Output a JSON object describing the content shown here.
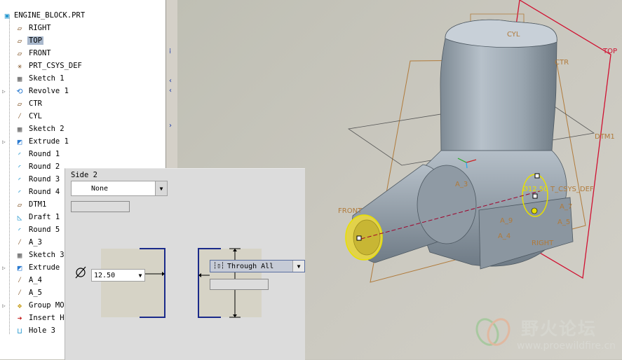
{
  "model_tree": {
    "items": [
      {
        "label": "ENGINE_BLOCK.PRT",
        "icon": "part-icon",
        "expand": ""
      },
      {
        "label": "RIGHT",
        "icon": "datum-plane-icon",
        "expand": ""
      },
      {
        "label": "TOP",
        "icon": "datum-plane-icon",
        "expand": "",
        "selected": true
      },
      {
        "label": "FRONT",
        "icon": "datum-plane-icon",
        "expand": ""
      },
      {
        "label": "PRT_CSYS_DEF",
        "icon": "csys-icon",
        "expand": ""
      },
      {
        "label": "Sketch 1",
        "icon": "sketch-icon",
        "expand": ""
      },
      {
        "label": "Revolve 1",
        "icon": "revolve-icon",
        "expand": "▷"
      },
      {
        "label": "CTR",
        "icon": "datum-plane-icon",
        "expand": ""
      },
      {
        "label": "CYL",
        "icon": "datum-axis-icon",
        "expand": ""
      },
      {
        "label": "Sketch 2",
        "icon": "sketch-icon",
        "expand": ""
      },
      {
        "label": "Extrude 1",
        "icon": "extrude-icon",
        "expand": "▷"
      },
      {
        "label": "Round 1",
        "icon": "round-icon",
        "expand": ""
      },
      {
        "label": "Round 2",
        "icon": "round-icon",
        "expand": ""
      },
      {
        "label": "Round 3",
        "icon": "round-icon",
        "expand": ""
      },
      {
        "label": "Round 4",
        "icon": "round-icon",
        "expand": ""
      },
      {
        "label": "DTM1",
        "icon": "datum-plane-icon",
        "expand": ""
      },
      {
        "label": "Draft 1",
        "icon": "draft-icon",
        "expand": ""
      },
      {
        "label": "Round 5",
        "icon": "round-icon",
        "expand": ""
      },
      {
        "label": "A_3",
        "icon": "datum-axis-icon",
        "expand": ""
      },
      {
        "label": "Sketch 3",
        "icon": "sketch-icon",
        "expand": ""
      },
      {
        "label": "Extrude 2",
        "icon": "extrude-icon",
        "expand": "▷"
      },
      {
        "label": "A_4",
        "icon": "datum-axis-icon",
        "expand": ""
      },
      {
        "label": "A_5",
        "icon": "datum-axis-icon",
        "expand": ""
      },
      {
        "label": "Group MOU",
        "icon": "group-icon",
        "expand": "▷"
      },
      {
        "label": "Insert He",
        "icon": "insert-here-icon",
        "expand": ""
      },
      {
        "label": "Hole 3",
        "icon": "hole-icon",
        "expand": ""
      }
    ]
  },
  "hole_panel": {
    "side2_label": "Side 2",
    "side2_value": "None",
    "diameter_value": "12.50",
    "depth_option": "Through All"
  },
  "viewport_labels": {
    "cyl": "CYL",
    "ctr": "CTR",
    "top": "TOP",
    "dtm1": "DTM1",
    "front": "FRONT",
    "right": "RIGHT",
    "a3": "A_3",
    "a7": "A_7",
    "a5": "A_5",
    "a9": "A_9",
    "a4": "A_4",
    "dim": "Ø12.50",
    "csys": "T_CSYS_DEF"
  },
  "watermark": {
    "title": "野火论坛",
    "url": "www.proewildfire.cn"
  },
  "colors": {
    "datum_plane": "#b07a3a",
    "top_plane": "#d01030",
    "selection": "#e8e000",
    "tree_selected": "#a9b8cc"
  }
}
